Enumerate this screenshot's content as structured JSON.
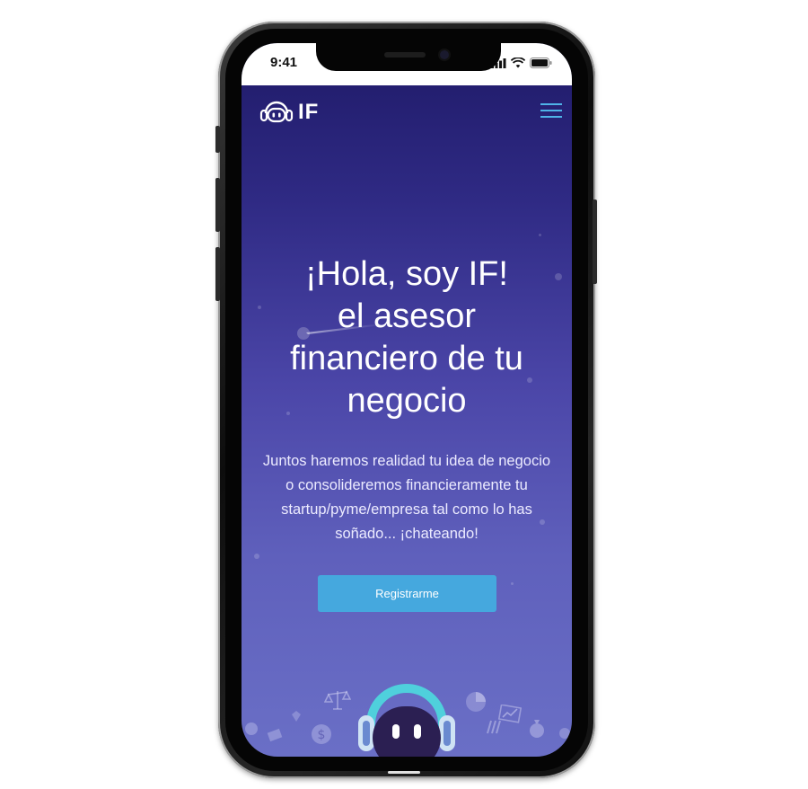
{
  "status_bar": {
    "time": "9:41"
  },
  "header": {
    "logo_text": "IF",
    "logo_icon": "robot-headphones-icon",
    "menu_icon": "hamburger-menu-icon"
  },
  "hero": {
    "headline_lines": [
      "¡Hola, soy IF!",
      "el asesor",
      "financiero de tu",
      "negocio"
    ],
    "subtext_lines": [
      "Juntos haremos realidad tu idea de negocio",
      "o consolideremos financieramente tu",
      "startup/pyme/empresa tal como lo has",
      "soñado... ¡chateando!"
    ],
    "cta_label": "Registrarme"
  },
  "colors": {
    "accent": "#45a8de",
    "background_top": "#1f1a68",
    "background_bottom": "#6a6fc6",
    "text": "#ffffff"
  },
  "decorations": [
    "scale-icon",
    "dollar-coin-icon",
    "chart-icon",
    "money-bag-icon",
    "robot-mascot"
  ]
}
